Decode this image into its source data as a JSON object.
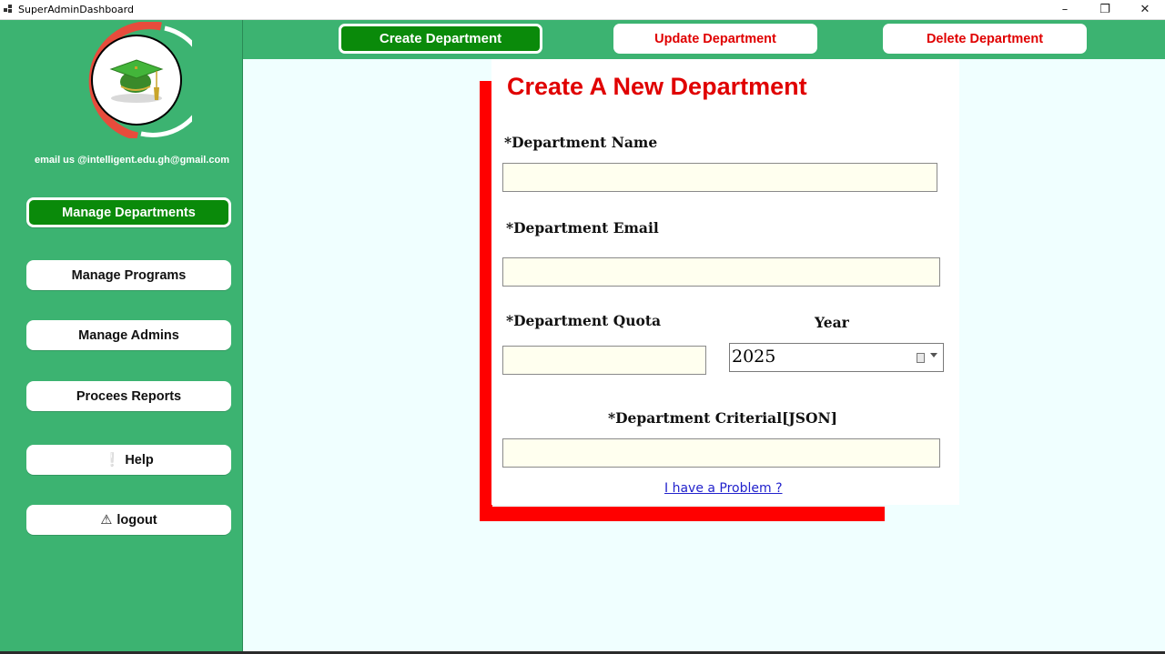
{
  "window": {
    "title": "SuperAdminDashboard",
    "controls": {
      "minimize": "–",
      "restore": "❐",
      "close": "✕"
    }
  },
  "sidebar": {
    "email": "email us @intelligent.edu.gh@gmail.com",
    "logo_icon": "graduation-cap-icon",
    "items": [
      {
        "label": "Manage Departments",
        "active": true
      },
      {
        "label": "Manage Programs"
      },
      {
        "label": "Manage Admins"
      },
      {
        "label": "Procees Reports"
      },
      {
        "label": "Help",
        "symbol": "❕"
      },
      {
        "label": "logout",
        "symbol": "⚠"
      }
    ]
  },
  "topbar": {
    "tabs": [
      {
        "label": "Create Department",
        "active": true
      },
      {
        "label": "Update Department"
      },
      {
        "label": "Delete Department"
      }
    ]
  },
  "form": {
    "title": "Create A New Department",
    "name_label": "*Department Name",
    "name_value": "",
    "email_label": "*Department Email",
    "email_value": "",
    "quota_label": "*Department Quota",
    "quota_value": "",
    "year_label": "Year",
    "year_value": "2025",
    "criteria_label": "*Department Criterial[JSON]",
    "criteria_value": "",
    "problem_link": "I have a Problem ?"
  },
  "colors": {
    "sidebar_green": "#3cb371",
    "active_green": "#0a8a0a",
    "accent_red": "#ff0000",
    "field_bg": "#ffffef",
    "page_bg": "#f0ffff"
  }
}
